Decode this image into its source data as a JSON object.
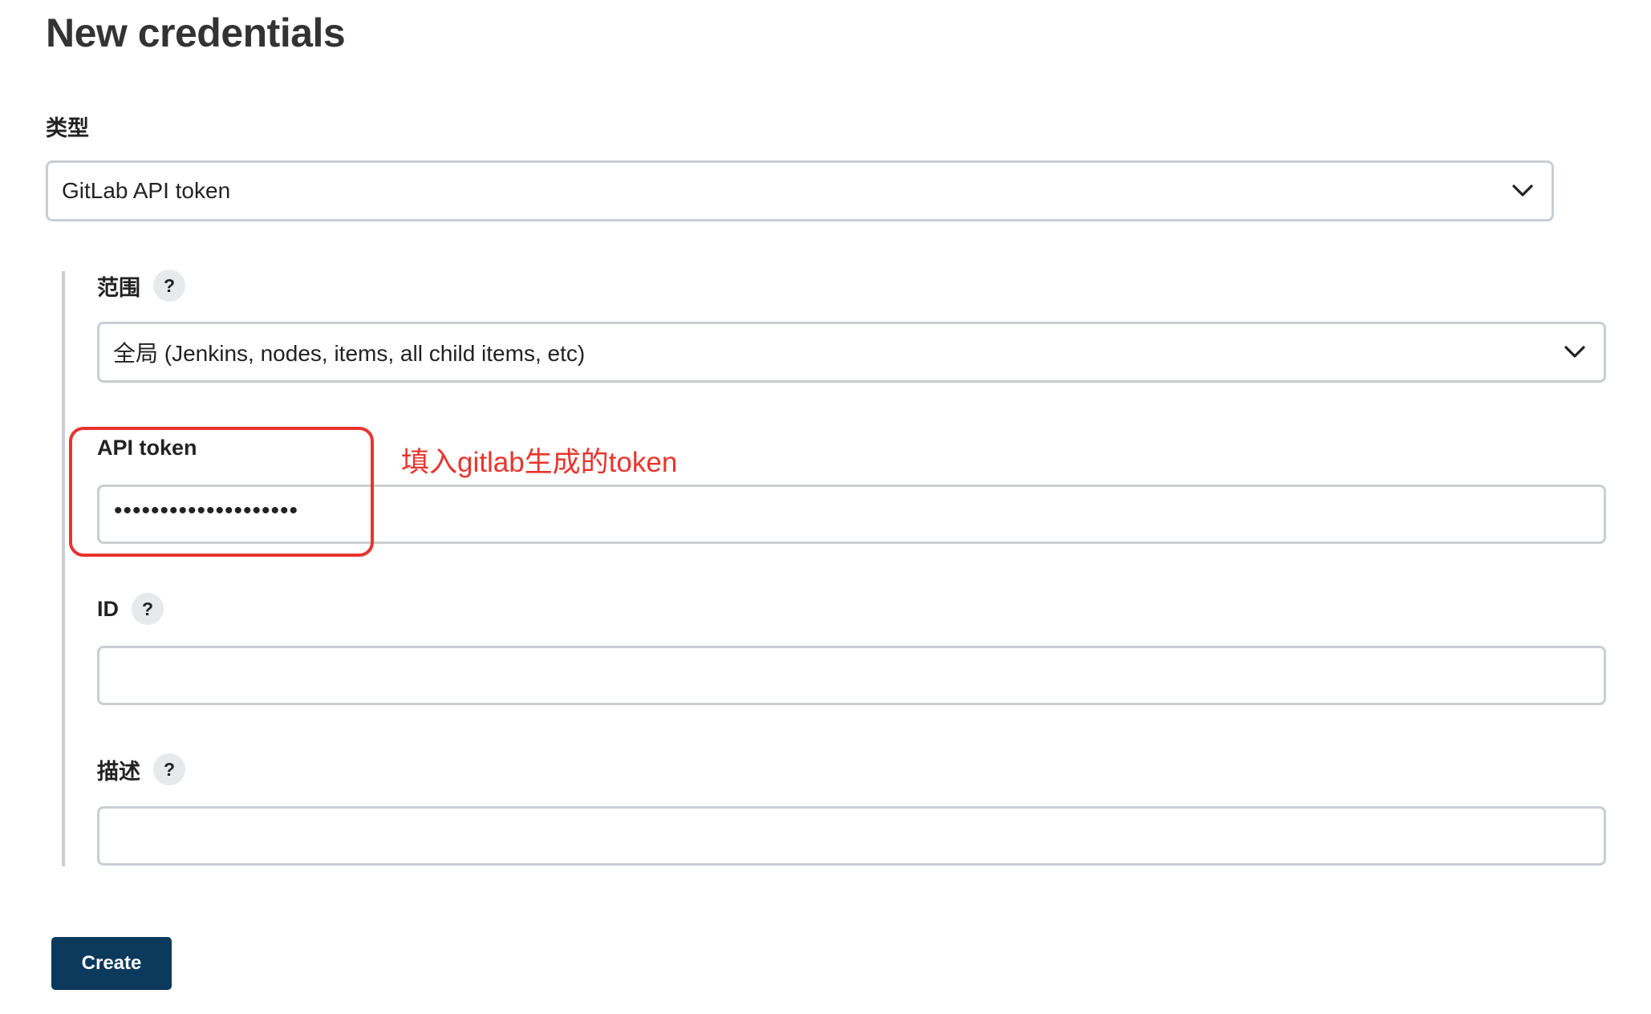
{
  "page": {
    "title": "New credentials"
  },
  "kind": {
    "label": "类型",
    "selected": "GitLab API token",
    "icon": "chevron-down-icon"
  },
  "scope": {
    "label": "范围",
    "help": "?",
    "selected": "全局 (Jenkins, nodes, items, all child items, etc)",
    "icon": "chevron-down-icon"
  },
  "api_token": {
    "label": "API token",
    "value": "••••••••••••••••••••"
  },
  "id_field": {
    "label": "ID",
    "help": "?",
    "value": ""
  },
  "description": {
    "label": "描述",
    "help": "?",
    "value": ""
  },
  "annotation": {
    "text": "填入gitlab生成的token",
    "color": "#e8342d"
  },
  "actions": {
    "create_label": "Create"
  },
  "colors": {
    "primary_button": "#0b3a5c",
    "input_border": "#c9ced3"
  }
}
